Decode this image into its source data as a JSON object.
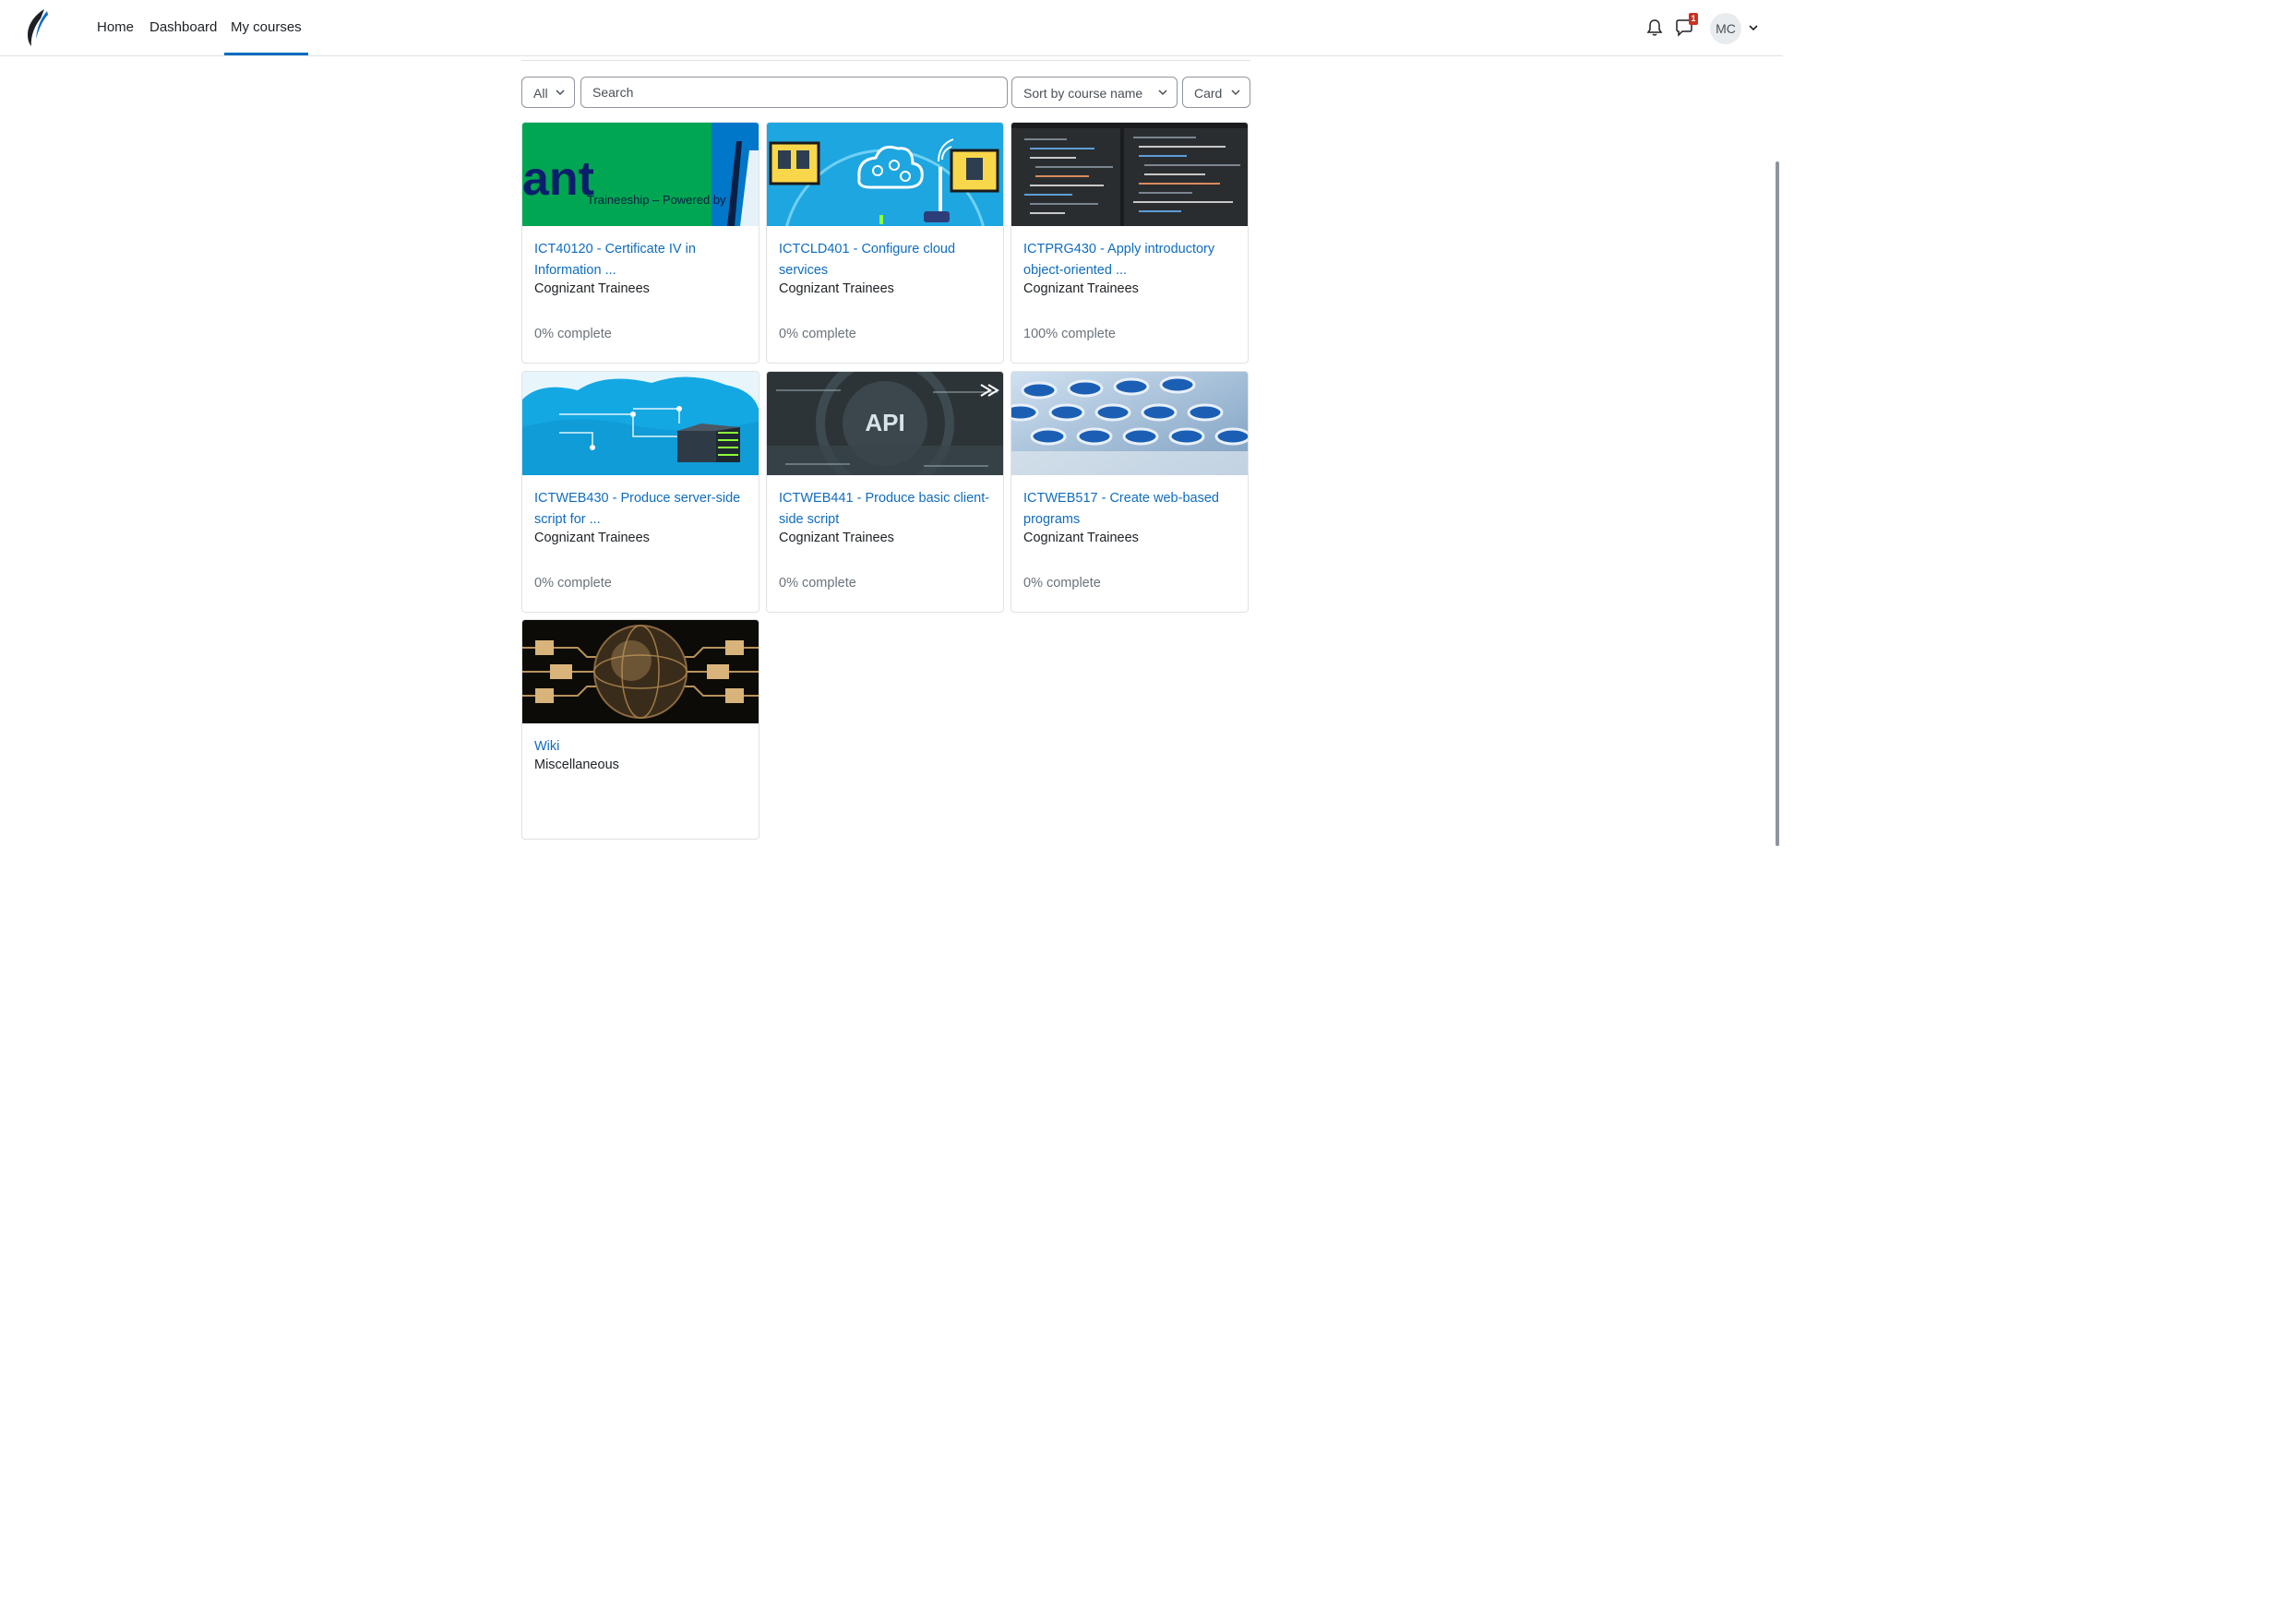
{
  "nav": {
    "items": [
      {
        "label": "Home",
        "active": false
      },
      {
        "label": "Dashboard",
        "active": false
      },
      {
        "label": "My courses",
        "active": true
      }
    ],
    "notifications_icon": "bell-icon",
    "messages_icon": "chat-icon",
    "messages_badge": "1",
    "user_initials": "MC",
    "accent_color": "#0f6cbf"
  },
  "filters": {
    "grouping": "All",
    "search_placeholder": "Search",
    "sort": "Sort by course name",
    "view": "Card"
  },
  "courses": [
    {
      "title": "ICT40120 - Certificate IV in Information ...",
      "category": "Cognizant Trainees",
      "progress": "0% complete",
      "progress_value": 0,
      "image": "traineeship-banner"
    },
    {
      "title": "ICTCLD401 - Configure cloud services",
      "category": "Cognizant Trainees",
      "progress": "0% complete",
      "progress_value": 0,
      "image": "cloud-illustration"
    },
    {
      "title": "ICTPRG430 - Apply introductory object-oriented ...",
      "category": "Cognizant Trainees",
      "progress": "100% complete",
      "progress_value": 100,
      "image": "code-screen"
    },
    {
      "title": "ICTWEB430 - Produce server-side script for ...",
      "category": "Cognizant Trainees",
      "progress": "0% complete",
      "progress_value": 0,
      "image": "cloud-server"
    },
    {
      "title": "ICTWEB441 - Produce basic client-side script",
      "category": "Cognizant Trainees",
      "progress": "0% complete",
      "progress_value": 0,
      "image": "api-graphic"
    },
    {
      "title": "ICTWEB517 - Create web-based programs",
      "category": "Cognizant Trainees",
      "progress": "0% complete",
      "progress_value": 0,
      "image": "hex-keys"
    },
    {
      "title": "Wiki",
      "category": "Miscellaneous",
      "progress": "",
      "image": "circuit-globe"
    }
  ],
  "banner_text": {
    "left": "ant",
    "middle": "Traineeship – Powered by",
    "api": "API"
  }
}
